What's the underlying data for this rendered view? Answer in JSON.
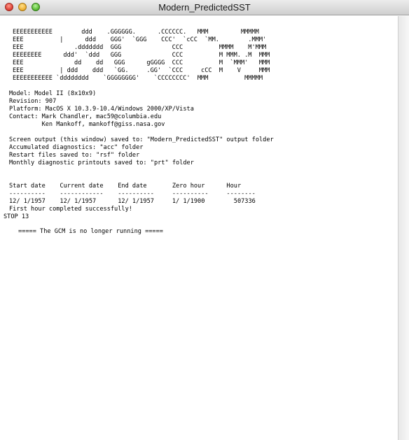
{
  "window": {
    "title": "Modern_PredictedSST"
  },
  "terminal": {
    "banner": [
      "EEEEEEEEEEE        ddd    .GGGGGG.      .CCCCCC.   MMM         MMMMM",
      "EEE          |      ddd    GGG'  `GGG    CCC'  `cCC  `MM.        .MMM'",
      "EEE              .ddddddd  GGG              CCC          MMMM    M'MMM",
      "EEEEEEEE      ddd'  `ddd   GGG              CCC          M MMM. .M  MMM",
      "EEE              dd    dd   GGG      gGGGG  CCC          M  `MMM'   MMM",
      "EEE          | ddd    ddd   `GG.     .GG'  `CCC     cCC  M    V     MMM",
      "EEEEEEEEEEE `dddddddd    `GGGGGGGG'    `CCCCCCCC'  MMM          MMMMM"
    ],
    "info": [
      "Model: Model II (8x10x9)",
      "Revision: 907",
      "Platform: MacOS X 10.3.9-10.4/Windows 2000/XP/Vista",
      "Contact: Mark Chandler, mac59@columbia.edu",
      "         Ken Mankoff, mankoff@giss.nasa.gov"
    ],
    "output": [
      "Screen output (this window) saved to: \"Modern_PredictedSST\" output folder",
      "Accumulated diagnostics: \"acc\" folder",
      "Restart files saved to: \"rsf\" folder",
      "Monthly diagnostic printouts saved to: \"prt\" folder"
    ],
    "table": {
      "header": "Start date    Current date    End date       Zero hour      Hour",
      "separator": "----------    ------------    ----------     ----------     --------",
      "row": "12/ 1/1957    12/ 1/1957      12/ 1/1957     1/ 1/1900        507336"
    },
    "status": [
      "First hour completed successfully!",
      "STOP 13"
    ],
    "footer": "===== The GCM is no longer running ====="
  }
}
